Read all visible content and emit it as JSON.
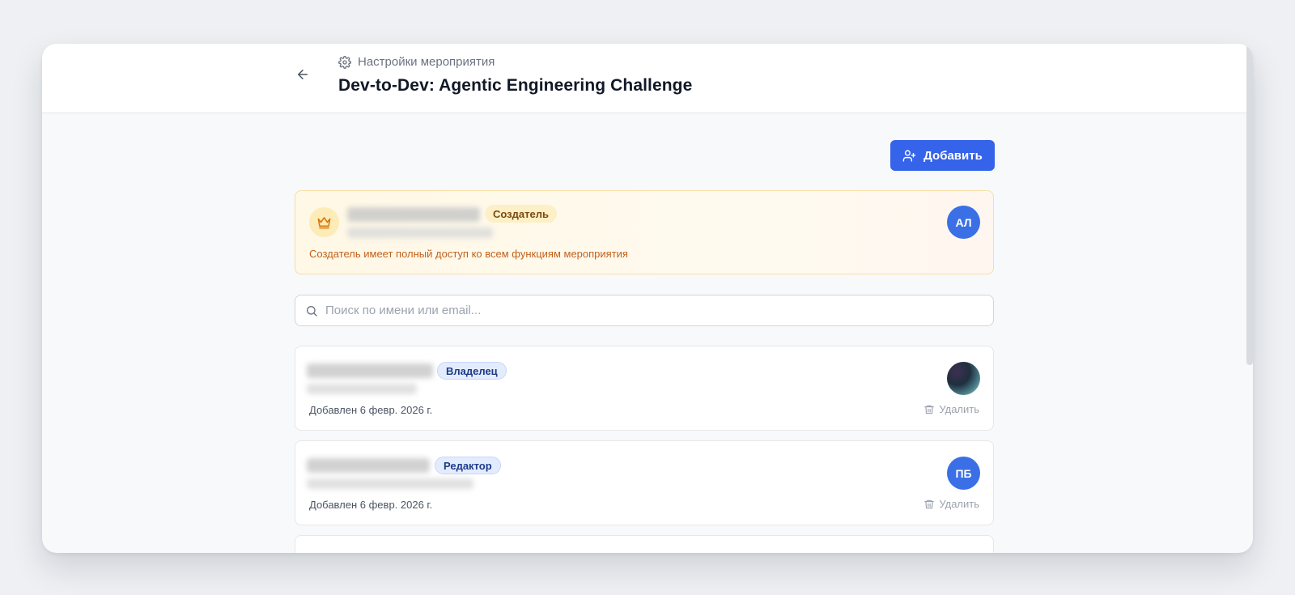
{
  "header": {
    "breadcrumb": "Настройки мероприятия",
    "title": "Dev-to-Dev: Agentic Engineering Challenge"
  },
  "toolbar": {
    "add_label": "Добавить"
  },
  "creator": {
    "badge": "Создатель",
    "avatar_initials": "АЛ",
    "note": "Создатель имеет полный доступ ко всем функциям мероприятия"
  },
  "search": {
    "placeholder": "Поиск по имени или email..."
  },
  "members": [
    {
      "role": "Владелец",
      "added": "Добавлен 6 февр. 2026 г.",
      "delete_label": "Удалить",
      "avatar": "photo"
    },
    {
      "role": "Редактор",
      "added": "Добавлен 6 февр. 2026 г.",
      "delete_label": "Удалить",
      "avatar_initials": "ПБ"
    }
  ],
  "colors": {
    "accent": "#3563e9",
    "creator_bg": "#fff8e6",
    "creator_text": "#c2611a"
  }
}
